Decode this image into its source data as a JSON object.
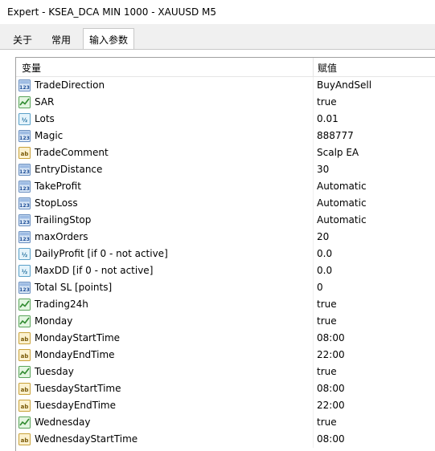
{
  "window": {
    "title": "Expert - KSEA_DCA MIN 1000 - XAUUSD M5"
  },
  "tabs": [
    {
      "label": "关于",
      "active": false
    },
    {
      "label": "常用",
      "active": false
    },
    {
      "label": "输入参数",
      "active": true
    }
  ],
  "grid": {
    "headers": {
      "variable": "变量",
      "value": "赋值"
    },
    "rows": [
      {
        "icon": "int",
        "name": "TradeDirection",
        "value": "BuyAndSell"
      },
      {
        "icon": "bool",
        "name": "SAR",
        "value": "true"
      },
      {
        "icon": "double",
        "name": "Lots",
        "value": "0.01"
      },
      {
        "icon": "int",
        "name": "Magic",
        "value": "888777"
      },
      {
        "icon": "string",
        "name": "TradeComment",
        "value": "Scalp EA"
      },
      {
        "icon": "int",
        "name": "EntryDistance",
        "value": "30"
      },
      {
        "icon": "int",
        "name": "TakeProfit",
        "value": "Automatic"
      },
      {
        "icon": "int",
        "name": "StopLoss",
        "value": "Automatic"
      },
      {
        "icon": "int",
        "name": "TrailingStop",
        "value": "Automatic"
      },
      {
        "icon": "int",
        "name": "maxOrders",
        "value": "20"
      },
      {
        "icon": "double",
        "name": "DailyProfit [if 0 - not active]",
        "value": "0.0"
      },
      {
        "icon": "double",
        "name": "MaxDD [if 0 - not active]",
        "value": "0.0"
      },
      {
        "icon": "int",
        "name": "Total SL [points]",
        "value": "0"
      },
      {
        "icon": "bool",
        "name": "Trading24h",
        "value": "true"
      },
      {
        "icon": "bool",
        "name": "Monday",
        "value": "true"
      },
      {
        "icon": "string",
        "name": "MondayStartTime",
        "value": "08:00"
      },
      {
        "icon": "string",
        "name": "MondayEndTime",
        "value": "22:00"
      },
      {
        "icon": "bool",
        "name": "Tuesday",
        "value": "true"
      },
      {
        "icon": "string",
        "name": "TuesdayStartTime",
        "value": "08:00"
      },
      {
        "icon": "string",
        "name": "TuesdayEndTime",
        "value": "22:00"
      },
      {
        "icon": "bool",
        "name": "Wednesday",
        "value": "true"
      },
      {
        "icon": "string",
        "name": "WednesdayStartTime",
        "value": "08:00"
      }
    ]
  }
}
